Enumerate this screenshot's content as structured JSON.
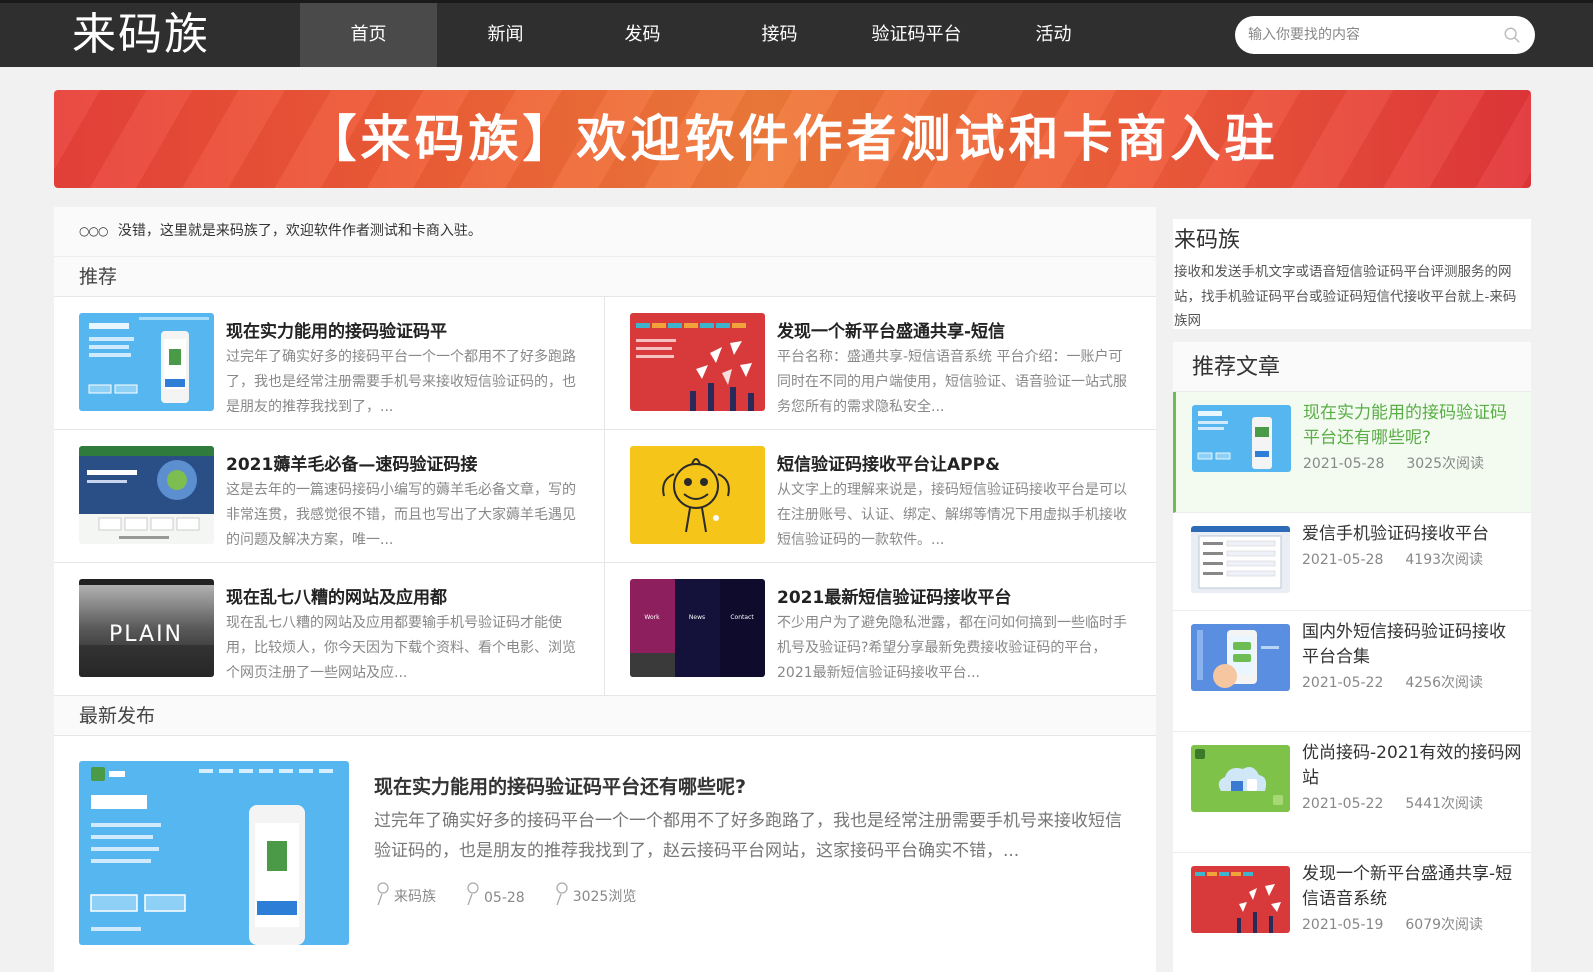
{
  "header": {
    "logo": "来码族",
    "nav": [
      "首页",
      "新闻",
      "发码",
      "接码",
      "验证码平台",
      "活动"
    ],
    "search_placeholder": "输入你要找的内容"
  },
  "banner": {
    "text": "【来码族】欢迎软件作者测试和卡商入驻"
  },
  "notice": {
    "dots": "○○○",
    "text": "没错，这里就是来码族了，欢迎软件作者测试和卡商入驻。"
  },
  "recommend": {
    "title": "推荐",
    "cards": [
      {
        "title": "现在实力能用的接码验证码平",
        "desc": "过完年了确实好多的接码平台一个一个都用不了好多跑路了，我也是经常注册需要手机号来接收短信验证码的，也是朋友的推荐我找到了，..."
      },
      {
        "title": "发现一个新平台盛通共享-短信",
        "desc": "平台名称：盛通共享-短信语音系统 平台介绍：一账户可同时在不同的用户端使用，短信验证、语音验证一站式服务您所有的需求隐私安全..."
      },
      {
        "title": "2021薅羊毛必备—速码验证码接",
        "desc": "这是去年的一篇速码接码小编写的薅羊毛必备文章，写的非常连贯，我感觉很不错，而且也写出了大家薅羊毛遇见的问题及解决方案，唯一..."
      },
      {
        "title": "短信验证码接收平台让APP&",
        "desc": "从文字上的理解来说是，接码短信验证码接收平台是可以在注册账号、认证、绑定、解绑等情况下用虚拟手机接收短信验证码的一款软件。..."
      },
      {
        "title": "现在乱七八糟的网站及应用都",
        "desc": "现在乱七八糟的网站及应用都要输手机号验证码才能使用，比较烦人，你今天因为下载个资料、看个电影、浏览个网页注册了一些网站及应..."
      },
      {
        "title": "2021最新短信验证码接收平台",
        "desc": "不少用户为了避免隐私泄露，都在问如何搞到一些临时手机号及验证码?希望分享最新免费接收验证码的平台，2021最新短信验证码接收平台..."
      }
    ]
  },
  "latest": {
    "title": "最新发布",
    "item": {
      "title": "现在实力能用的接码验证码平台还有哪些呢?",
      "desc": "过完年了确实好多的接码平台一个一个都用不了好多跑路了，我也是经常注册需要手机号来接收短信验证码的，也是朋友的推荐我找到了，赵云接码平台网站，这家接码平台确实不错，...",
      "author": "来码族",
      "date": "05-28",
      "views": "3025浏览"
    }
  },
  "sidebar": {
    "about_title": "来码族",
    "about_desc": "接收和发送手机文字或语音短信验证码平台评测服务的网站，找手机验证码平台或验证码短信代接收平台就上-来码族网",
    "rec_title": "推荐文章",
    "items": [
      {
        "title": "现在实力能用的接码验证码平台还有哪些呢?",
        "date": "2021-05-28",
        "views": "3025次阅读"
      },
      {
        "title": "爱信手机验证码接收平台",
        "date": "2021-05-28",
        "views": "4193次阅读"
      },
      {
        "title": "国内外短信接码验证码接收平台合集",
        "date": "2021-05-22",
        "views": "4256次阅读"
      },
      {
        "title": "优尚接码-2021有效的接码网站",
        "date": "2021-05-22",
        "views": "5441次阅读"
      },
      {
        "title": "发现一个新平台盛通共享-短信语音系统",
        "date": "2021-05-19",
        "views": "6079次阅读"
      }
    ]
  },
  "thumb_texts": {
    "plain": "PLAIN",
    "work": "Work",
    "news": "News",
    "contact": "Contact"
  },
  "colors": {
    "accent_green": "#5aae46",
    "header_bg": "#2f2f2f",
    "banner_red": "#e8413a"
  }
}
